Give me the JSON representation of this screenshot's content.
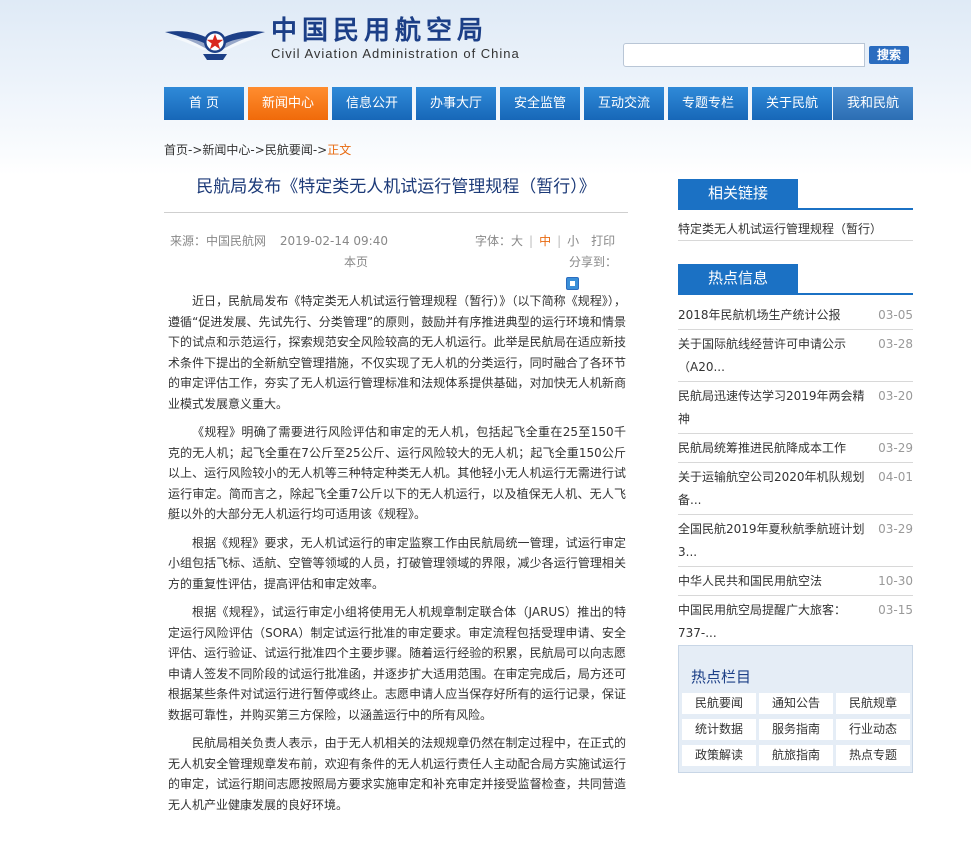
{
  "header": {
    "logo_cn": "中国民用航空局",
    "logo_en": "Civil Aviation Administration of China",
    "search_value": "",
    "search_button": "搜索"
  },
  "nav": [
    "首 页",
    "新闻中心",
    "信息公开",
    "办事大厅",
    "安全监管",
    "互动交流",
    "专题专栏",
    "关于民航",
    "我和民航"
  ],
  "breadcrumb": {
    "home": "首页",
    "sep": "->",
    "news_center": "新闻中心",
    "news": "民航要闻",
    "current": "正文"
  },
  "article": {
    "title": "民航局发布《特定类无人机试运行管理规程（暂行）》",
    "source": "来源：中国民航网",
    "date": "2019-02-14 09:40",
    "font_label": "字体：",
    "font_large": "大",
    "font_mid": "中",
    "font_small": "小",
    "print": "打印",
    "print_page": "本页",
    "share": "分享到：",
    "paragraphs": [
      "近日，民航局发布《特定类无人机试运行管理规程（暂行）》（以下简称《规程》），遵循“促进发展、先试先行、分类管理”的原则，鼓励并有序推进典型的运行环境和情景下的试点和示范运行，探索规范安全风险较高的无人机运行。此举是民航局在适应新技术条件下提出的全新航空管理措施，不仅实现了无人机的分类运行，同时融合了各环节的审定评估工作，夯实了无人机运行管理标准和法规体系提供基础，对加快无人机新商业模式发展意义重大。",
      "《规程》明确了需要进行风险评估和审定的无人机，包括起飞全重在25至150千克的无人机；起飞全重在7公斤至25公斤、运行风险较大的无人机；起飞全重150公斤以上、运行风险较小的无人机等三种特定种类无人机。其他轻小无人机运行无需进行试运行审定。简而言之，除起飞全重7公斤以下的无人机运行，以及植保无人机、无人飞艇以外的大部分无人机运行均可适用该《规程》。",
      "根据《规程》要求，无人机试运行的审定监察工作由民航局统一管理，试运行审定小组包括飞标、适航、空管等领域的人员，打破管理领域的界限，减少各运行管理相关方的重复性评估，提高评估和审定效率。",
      "根据《规程》，试运行审定小组将使用无人机规章制定联合体（JARUS）推出的特定运行风险评估（SORA）制定试运行批准的审定要求。审定流程包括受理申请、安全评估、运行验证、试运行批准四个主要步骤。随着运行经验的积累，民航局可以向志愿申请人签发不同阶段的试运行批准函，并逐步扩大适用范围。在审定完成后，局方还可根据某些条件对试运行进行暂停或终止。志愿申请人应当保存好所有的运行记录，保证数据可靠性，并购买第三方保险，以涵盖运行中的所有风险。",
      "民航局相关负责人表示，由于无人机相关的法规规章仍然在制定过程中，在正式的无人机安全管理规章发布前，欢迎有条件的无人机运行责任人主动配合局方实施试运行的审定，试运行期间志愿按照局方要求实施审定和补充审定并接受监督检查，共同营造无人机产业健康发展的良好环境。"
    ]
  },
  "sidebar": {
    "related_title": "相关链接",
    "related_links": [
      "特定类无人机试运行管理规程（暂行）"
    ],
    "hot_title": "热点信息",
    "hot_items": [
      {
        "title": "2018年民航机场生产统计公报",
        "date": "03-05"
      },
      {
        "title": "关于国际航线经营许可申请公示（A20...",
        "date": "03-28"
      },
      {
        "title": "民航局迅速传达学习2019年两会精神",
        "date": "03-20"
      },
      {
        "title": "民航局统筹推进民航降成本工作",
        "date": "03-29"
      },
      {
        "title": "关于运输航空公司2020年机队规划备...",
        "date": "04-01"
      },
      {
        "title": "全国民航2019年夏秋航季航班计划3...",
        "date": "03-29"
      },
      {
        "title": "中华人民共和国民用航空法",
        "date": "10-30"
      },
      {
        "title": "中国民用航空局提醒广大旅客：737-...",
        "date": "03-15"
      }
    ],
    "columns_title": "热点栏目",
    "columns": [
      "民航要闻",
      "通知公告",
      "民航规章",
      "统计数据",
      "服务指南",
      "行业动态",
      "政策解读",
      "航旅指南",
      "热点专题"
    ]
  },
  "colors": {
    "nav_blue": "#1767b8",
    "nav_active": "#f06a0a",
    "title_blue": "#1c3a78",
    "accent_orange": "#e86a10"
  }
}
